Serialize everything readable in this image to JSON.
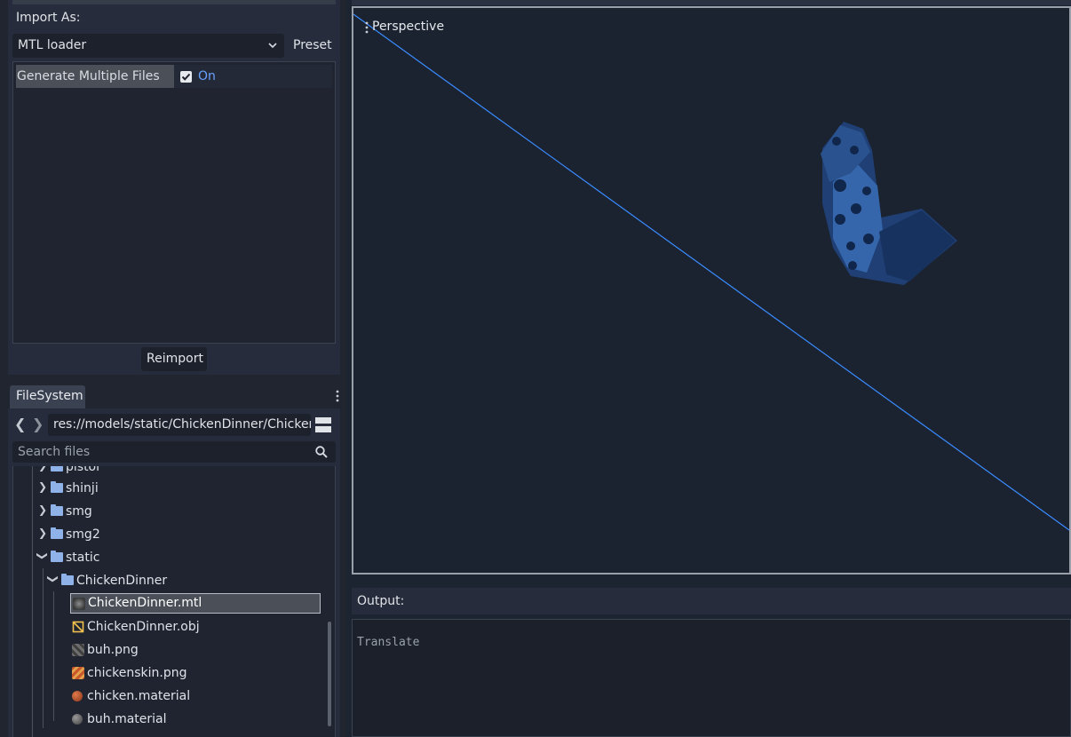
{
  "import": {
    "label": "Import As:",
    "importer": "MTL loader",
    "preset_label": "Preset",
    "option_name": "Generate Multiple Files",
    "option_value": "On",
    "reimport_label": "Reimport"
  },
  "filesystem": {
    "tab_label": "FileSystem",
    "back_glyph": "❮",
    "forward_glyph": "❯",
    "path": "res://models/static/ChickenDinner/ChickenDinner.mtl",
    "search_placeholder": "Search files",
    "tree": [
      {
        "label": "pistol",
        "type": "folder",
        "expanded": false
      },
      {
        "label": "shinji",
        "type": "folder",
        "expanded": false
      },
      {
        "label": "smg",
        "type": "folder",
        "expanded": false
      },
      {
        "label": "smg2",
        "type": "folder",
        "expanded": false
      },
      {
        "label": "static",
        "type": "folder",
        "expanded": true
      },
      {
        "label": "ChickenDinner",
        "type": "folder",
        "expanded": true
      },
      {
        "label": "ChickenDinner.mtl",
        "type": "mtl-file",
        "selected": true
      },
      {
        "label": "ChickenDinner.obj",
        "type": "obj-file"
      },
      {
        "label": "buh.png",
        "type": "png-file"
      },
      {
        "label": "chickenskin.png",
        "type": "png-file"
      },
      {
        "label": "chicken.material",
        "type": "material-file"
      },
      {
        "label": "buh.material",
        "type": "material-file"
      }
    ]
  },
  "viewport": {
    "label": "Perspective"
  },
  "output": {
    "title": "Output:",
    "line": "Translate"
  },
  "colors": {
    "accent": "#6aa1ff",
    "axis_line": "#3a8bff",
    "mesh": "#2f5a9e"
  }
}
